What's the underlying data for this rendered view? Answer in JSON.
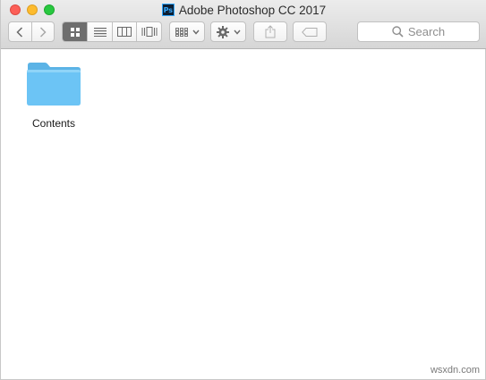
{
  "window": {
    "title": "Adobe Photoshop CC 2017",
    "app_icon_text": "Ps"
  },
  "toolbar": {
    "back_icon": "chevron-left-icon",
    "forward_icon": "chevron-right-icon",
    "view_modes": [
      "icon-view-icon",
      "list-view-icon",
      "column-view-icon",
      "cover-flow-icon"
    ],
    "active_view": "icon-view-icon",
    "arrange_icon": "arrange-grid-icon",
    "action_icon": "gear-icon",
    "share_icon": "share-icon",
    "tag_icon": "tag-icon",
    "search_placeholder": "Search"
  },
  "items": [
    {
      "name": "Contents",
      "kind": "folder",
      "icon": "folder-icon"
    }
  ],
  "watermark": "wsxdn.com",
  "colors": {
    "folder": "#6cc4f5",
    "folder_tab": "#5bb3e6",
    "close": "#fc5f57",
    "minimize": "#fdbb2d",
    "maximize": "#28c840"
  }
}
